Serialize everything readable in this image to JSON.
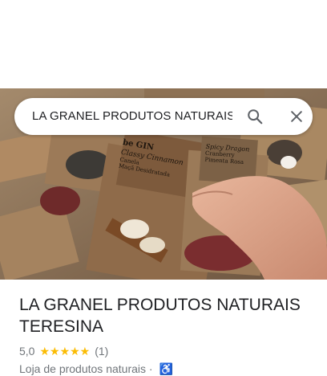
{
  "search": {
    "query": "LA GRANEL PRODUTOS NATURAIS TERESINA",
    "search_icon": "search-icon",
    "close_icon": "close-icon"
  },
  "hero": {
    "image_desc_icon": "place-photo",
    "packets": [
      {
        "brand": "be GIN",
        "line1": "Classy Cinnamon",
        "line2": "Canela",
        "line3": "Maçã Desidratada"
      },
      {
        "brand": "",
        "line1": "Spicy Dragon",
        "line2": "Cranberry",
        "line3": "Pimenta Rosa"
      }
    ]
  },
  "place": {
    "name": "LA GRANEL PRODUTOS NATURAIS TERESINA",
    "rating": "5,0",
    "stars": "★★★★★",
    "review_count": "(1)",
    "category": "Loja de produtos naturais ·",
    "accessibility_icon": "♿"
  },
  "colors": {
    "star": "#fbbc04",
    "text_primary": "#202124",
    "text_secondary": "#70757a"
  }
}
